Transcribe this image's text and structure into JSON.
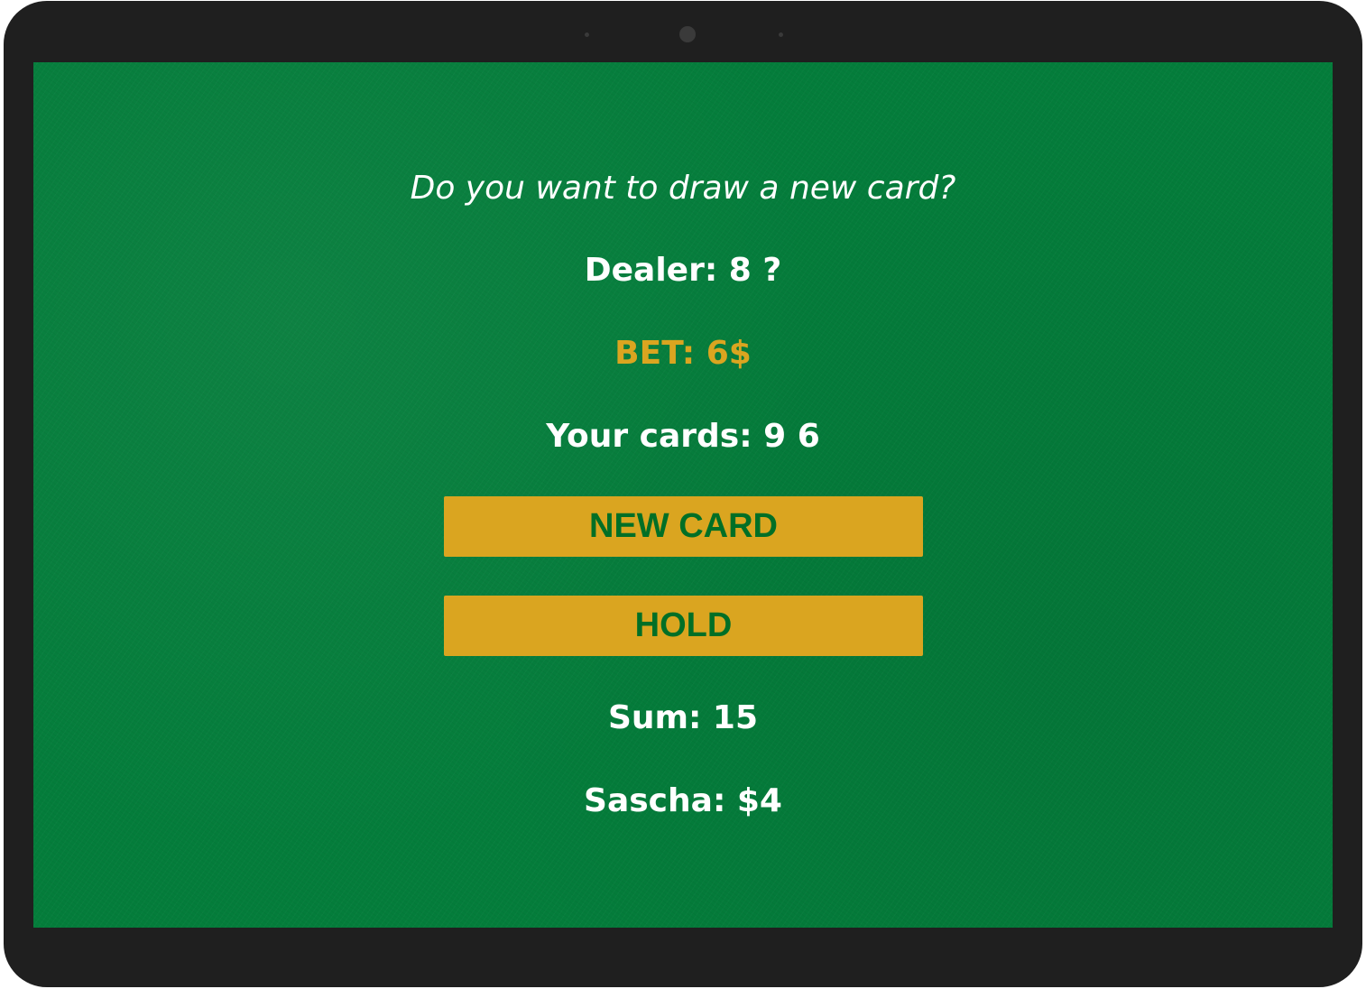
{
  "game": {
    "message": "Do you want to draw a new card?",
    "dealer": "Dealer: 8 ?",
    "bet": "BET: 6$",
    "cards": "Your cards: 9 6",
    "sum": "Sum: 15",
    "player": "Sascha: $4"
  },
  "buttons": {
    "new_card": "NEW CARD",
    "hold": "HOLD"
  },
  "colors": {
    "table_felt": "#047d3b",
    "accent": "#daa520",
    "button_text": "#016f26",
    "text": "#ffffff",
    "device_frame": "#1f1f1f"
  }
}
